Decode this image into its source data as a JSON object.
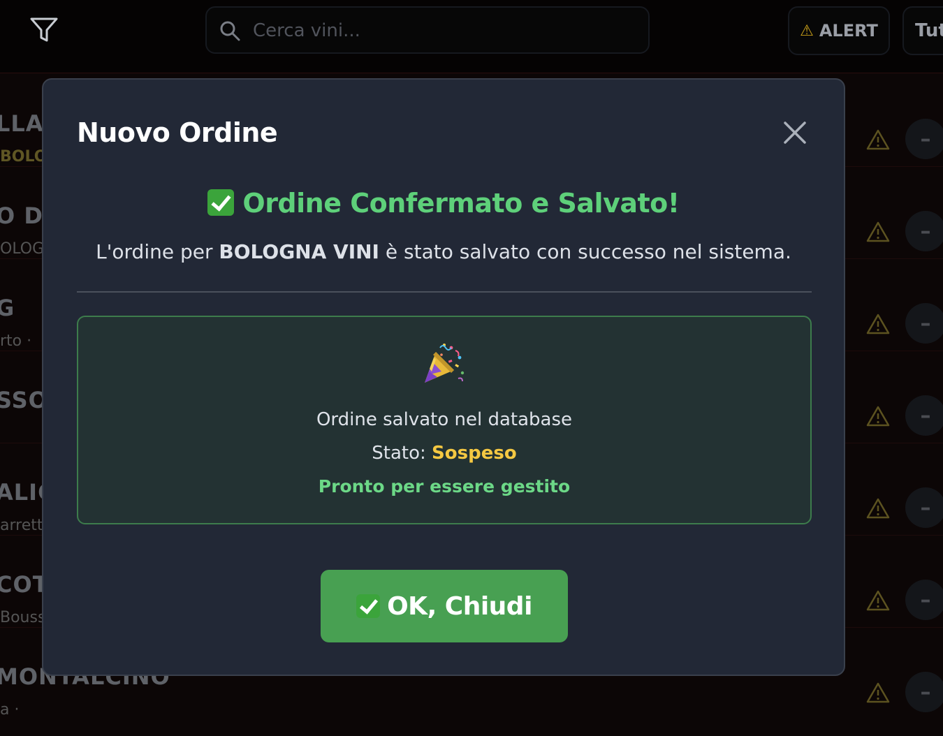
{
  "topbar": {
    "search": {
      "placeholder": "Cerca vini..."
    },
    "alert_label": "ALERT",
    "all_label": "Tut"
  },
  "list": {
    "rows": [
      {
        "name": "LLA",
        "sub": "BOLO"
      },
      {
        "name": "O DO",
        "sub": "OLOGN"
      },
      {
        "name": "G",
        "sub": "rto  ·"
      },
      {
        "name": "SSO",
        "sub": ""
      },
      {
        "name": "ALIG",
        "sub": "arrett"
      },
      {
        "name": "COT",
        "sub": "Bouss"
      },
      {
        "name": "MONTALCINO",
        "sub": "a  ·"
      }
    ],
    "minus_label": "–"
  },
  "modal": {
    "title": "Nuovo Ordine",
    "success_title": "Ordine Confermato e Salvato!",
    "message_prefix": "L'ordine per ",
    "message_bold": "BOLOGNA VINI",
    "message_suffix": " è stato salvato con successo nel sistema.",
    "info": {
      "saved_text": "Ordine salvato nel database",
      "status_label": "Stato: ",
      "status_value": "Sospeso",
      "ready_text": "Pronto per essere gestito"
    },
    "ok_button": "OK, Chiudi"
  },
  "colors": {
    "success_green": "#5ed07a",
    "status_yellow": "#f5c842",
    "button_green": "#48a052",
    "modal_bg": "#222836"
  }
}
